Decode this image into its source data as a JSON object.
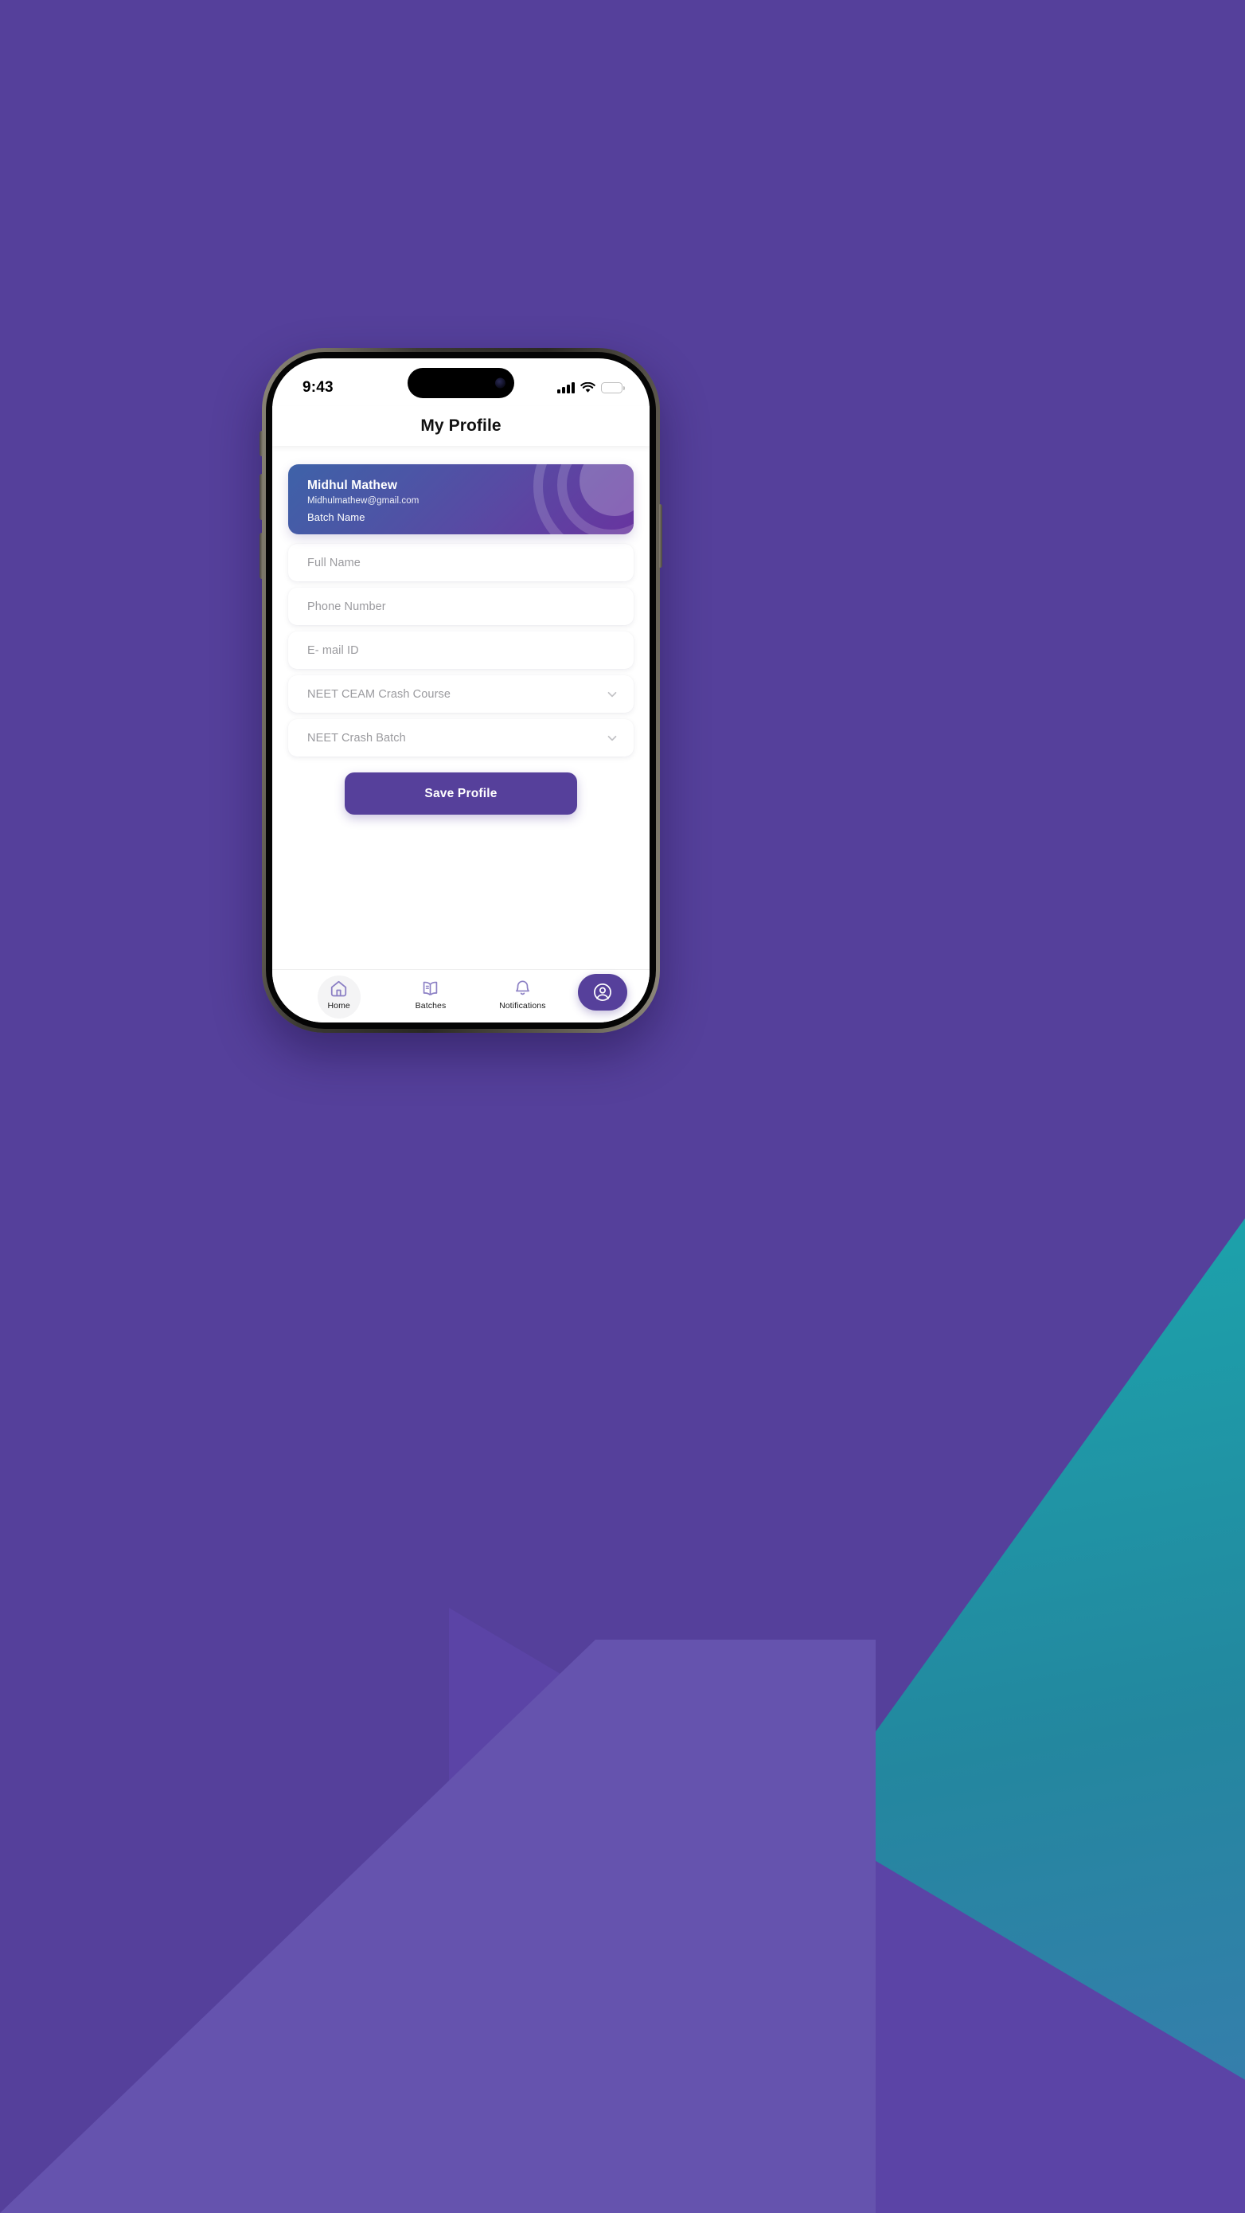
{
  "background": {
    "base_purple": "#55409B",
    "teal": "#1BA8AE",
    "wedge_purple": "#5B44A6",
    "light_band": "#6553AE"
  },
  "status_bar": {
    "time": "9:43",
    "icons": [
      "cellular-signal-icon",
      "wifi-icon",
      "battery-icon"
    ],
    "battery_level": 92
  },
  "header": {
    "title": "My Profile"
  },
  "profile_card": {
    "name": "Midhul Mathew",
    "email": "Midhulmathew@gmail.com",
    "batch": "Batch Name",
    "gradient_from": "#3E62A8",
    "gradient_to": "#68349F"
  },
  "form": {
    "fields": [
      {
        "name": "full-name",
        "placeholder": "Full Name",
        "type": "text",
        "value": ""
      },
      {
        "name": "phone-number",
        "placeholder": "Phone Number",
        "type": "text",
        "value": ""
      },
      {
        "name": "email-id",
        "placeholder": "E- mail ID",
        "type": "text",
        "value": ""
      },
      {
        "name": "course",
        "placeholder": "NEET CEAM Crash Course",
        "type": "select",
        "value": ""
      },
      {
        "name": "batch",
        "placeholder": "NEET Crash Batch",
        "type": "select",
        "value": ""
      }
    ],
    "save_label": "Save Profile",
    "accent_color": "#56409B"
  },
  "bottom_nav": {
    "items": [
      {
        "label": "Home",
        "icon": "home-icon",
        "active": false,
        "highlighted": true
      },
      {
        "label": "Batches",
        "icon": "book-icon",
        "active": false,
        "highlighted": false
      },
      {
        "label": "Notifications",
        "icon": "bell-icon",
        "active": false,
        "highlighted": false
      }
    ],
    "profile": {
      "icon": "user-circle-icon",
      "active": true,
      "background": "#56409B"
    }
  }
}
